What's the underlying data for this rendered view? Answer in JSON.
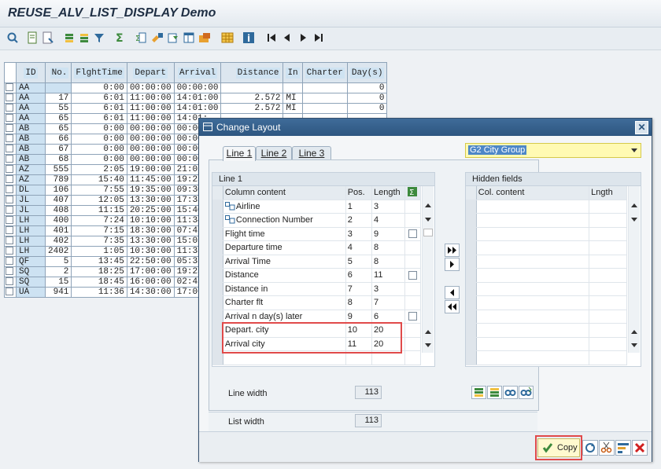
{
  "app": {
    "title": "REUSE_ALV_LIST_DISPLAY Demo"
  },
  "toolbar": {
    "icons": [
      "details-icon",
      "select-icon",
      "deselect-icon",
      "sort-ascending-icon",
      "sort-descending-icon",
      "filter-icon",
      "sum-icon",
      "subtotal-icon",
      "print-preview-icon",
      "export-icon",
      "spreadsheet-icon",
      "mail-icon",
      "change-layout-icon",
      "select-layout-icon",
      "info-icon",
      "first-page-icon",
      "previous-page-icon",
      "next-page-icon",
      "last-page-icon"
    ]
  },
  "alv": {
    "headers": [
      "ID",
      "No.",
      "FlghtTime",
      "Depart",
      "Arrival",
      "Distance",
      "In",
      "Charter",
      "Day(s)"
    ],
    "rows": [
      [
        "AA",
        "",
        "0:00",
        "00:00:00",
        "00:00:00",
        "",
        "",
        "",
        "0"
      ],
      [
        "AA",
        "17",
        "6:01",
        "11:00:00",
        "14:01:00",
        "2.572",
        "MI",
        "",
        "0"
      ],
      [
        "AA",
        "55",
        "6:01",
        "11:00:00",
        "14:01:00",
        "2.572",
        "MI",
        "",
        "0"
      ],
      [
        "AA",
        "65",
        "6:01",
        "11:00:00",
        "14:01:",
        "",
        "",
        "",
        ""
      ],
      [
        "AB",
        "65",
        "0:00",
        "00:00:00",
        "00:00:",
        "",
        "",
        "",
        ""
      ],
      [
        "AB",
        "66",
        "0:00",
        "00:00:00",
        "00:00:",
        "",
        "",
        "",
        ""
      ],
      [
        "AB",
        "67",
        "0:00",
        "00:00:00",
        "00:00:",
        "",
        "",
        "",
        ""
      ],
      [
        "AB",
        "68",
        "0:00",
        "00:00:00",
        "00:00:",
        "",
        "",
        "",
        ""
      ],
      [
        "AZ",
        "555",
        "2:05",
        "19:00:00",
        "21:05:",
        "",
        "",
        "",
        ""
      ],
      [
        "AZ",
        "789",
        "15:40",
        "11:45:00",
        "19:25:",
        "",
        "",
        "",
        ""
      ],
      [
        "DL",
        "106",
        "7:55",
        "19:35:00",
        "09:30:",
        "",
        "",
        "",
        ""
      ],
      [
        "JL",
        "407",
        "12:05",
        "13:30:00",
        "17:35:",
        "",
        "",
        "",
        ""
      ],
      [
        "JL",
        "408",
        "11:15",
        "20:25:00",
        "15:40:",
        "",
        "",
        "",
        ""
      ],
      [
        "LH",
        "400",
        "7:24",
        "10:10:00",
        "11:34:",
        "",
        "",
        "",
        ""
      ],
      [
        "LH",
        "401",
        "7:15",
        "18:30:00",
        "07:45:",
        "",
        "",
        "",
        ""
      ],
      [
        "LH",
        "402",
        "7:35",
        "13:30:00",
        "15:05:",
        "",
        "",
        "",
        ""
      ],
      [
        "LH",
        "2402",
        "1:05",
        "10:30:00",
        "11:35:",
        "",
        "",
        "",
        ""
      ],
      [
        "QF",
        "5",
        "13:45",
        "22:50:00",
        "05:35:",
        "",
        "",
        "",
        ""
      ],
      [
        "SQ",
        "2",
        "18:25",
        "17:00:00",
        "19:25:",
        "",
        "",
        "",
        ""
      ],
      [
        "SQ",
        "15",
        "18:45",
        "16:00:00",
        "02:45:",
        "",
        "",
        "",
        ""
      ],
      [
        "UA",
        "941",
        "11:36",
        "14:30:00",
        "17:06:",
        "",
        "",
        "",
        ""
      ]
    ]
  },
  "dialog": {
    "title": "Change Layout",
    "tabs": [
      "Line 1",
      "Line 2",
      "Line 3"
    ],
    "group_title": "Line 1",
    "columns": {
      "content": "Column content",
      "pos": "Pos.",
      "length": "Length"
    },
    "fields": [
      {
        "name": "Airline",
        "pos": "1",
        "len": "3",
        "key": true,
        "check": false
      },
      {
        "name": "Connection Number",
        "pos": "2",
        "len": "4",
        "key": true,
        "check": false
      },
      {
        "name": "Flight time",
        "pos": "3",
        "len": "9",
        "key": false,
        "check": true
      },
      {
        "name": "Departure time",
        "pos": "4",
        "len": "8",
        "key": false,
        "check": false
      },
      {
        "name": "Arrival Time",
        "pos": "5",
        "len": "8",
        "key": false,
        "check": false
      },
      {
        "name": "Distance",
        "pos": "6",
        "len": "11",
        "key": false,
        "check": true
      },
      {
        "name": "Distance in",
        "pos": "7",
        "len": "3",
        "key": false,
        "check": false
      },
      {
        "name": "Charter flt",
        "pos": "8",
        "len": "7",
        "key": false,
        "check": false
      },
      {
        "name": "Arrival n day(s) later",
        "pos": "9",
        "len": "6",
        "key": false,
        "check": true
      },
      {
        "name": "Depart. city",
        "pos": "10",
        "len": "20",
        "key": false,
        "check": false
      },
      {
        "name": "Arrival city",
        "pos": "11",
        "len": "20",
        "key": false,
        "check": false
      }
    ],
    "line_width_label": "Line width",
    "line_width": "113",
    "list_width_label": "List width",
    "list_width": "113",
    "hidden": {
      "title": "Hidden fields",
      "col_content": "Col. content",
      "length": "Lngth"
    },
    "variant": "G2 City Group",
    "copy_label": "Copy",
    "colors": {
      "highlight": "#e04a4a",
      "titlebar": "#2d5680",
      "selection": "#fffab3"
    }
  }
}
